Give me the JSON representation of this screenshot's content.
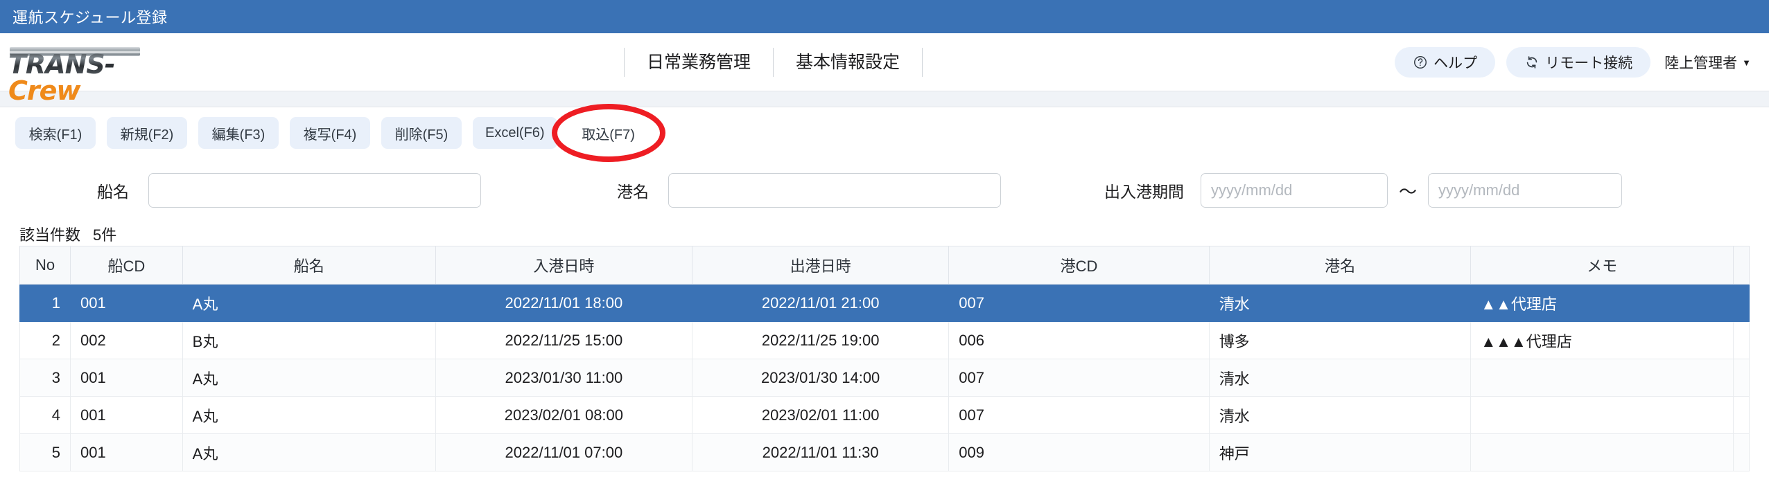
{
  "window": {
    "title": "運航スケジュール登録"
  },
  "brand": {
    "trans": "TRANS",
    "dash": "-",
    "crew": "Crew"
  },
  "nav": {
    "items": [
      {
        "label": "日常業務管理"
      },
      {
        "label": "基本情報設定"
      }
    ]
  },
  "header_actions": {
    "help": {
      "label": "ヘルプ",
      "icon": "question-circle-icon",
      "glyph": "?"
    },
    "remote": {
      "label": "リモート接続",
      "icon": "sync-icon",
      "glyph": "↻"
    },
    "user": {
      "label": "陸上管理者",
      "caret": "▼"
    }
  },
  "toolbar": {
    "buttons": [
      {
        "label": "検索(F1)",
        "highlighted": false
      },
      {
        "label": "新規(F2)",
        "highlighted": false
      },
      {
        "label": "編集(F3)",
        "highlighted": false
      },
      {
        "label": "複写(F4)",
        "highlighted": false
      },
      {
        "label": "削除(F5)",
        "highlighted": false
      },
      {
        "label": "Excel(F6)",
        "highlighted": false
      },
      {
        "label": "取込(F7)",
        "highlighted": true
      }
    ],
    "highlight_color": "#ee1d23"
  },
  "filters": {
    "ship_name": {
      "label": "船名",
      "value": "",
      "placeholder": ""
    },
    "port_name": {
      "label": "港名",
      "value": "",
      "placeholder": ""
    },
    "period": {
      "label": "出入港期間",
      "separator": "〜",
      "from": {
        "value": "",
        "placeholder": "yyyy/mm/dd"
      },
      "to": {
        "value": "",
        "placeholder": "yyyy/mm/dd"
      }
    }
  },
  "result": {
    "count_label": "該当件数",
    "count_text": "5件"
  },
  "table": {
    "columns": [
      "No",
      "船CD",
      "船名",
      "入港日時",
      "出港日時",
      "港CD",
      "港名",
      "メモ"
    ],
    "rows": [
      {
        "no": "1",
        "ship_cd": "001",
        "ship_name": "A丸",
        "arrival": "2022/11/01 18:00",
        "departure": "2022/11/01 21:00",
        "port_cd": "007",
        "port_name": "清水",
        "memo": "▲▲代理店",
        "selected": true
      },
      {
        "no": "2",
        "ship_cd": "002",
        "ship_name": "B丸",
        "arrival": "2022/11/25 15:00",
        "departure": "2022/11/25 19:00",
        "port_cd": "006",
        "port_name": "博多",
        "memo": "▲▲▲代理店",
        "selected": false
      },
      {
        "no": "3",
        "ship_cd": "001",
        "ship_name": "A丸",
        "arrival": "2023/01/30 11:00",
        "departure": "2023/01/30 14:00",
        "port_cd": "007",
        "port_name": "清水",
        "memo": "",
        "selected": false
      },
      {
        "no": "4",
        "ship_cd": "001",
        "ship_name": "A丸",
        "arrival": "2023/02/01 08:00",
        "departure": "2023/02/01 11:00",
        "port_cd": "007",
        "port_name": "清水",
        "memo": "",
        "selected": false
      },
      {
        "no": "5",
        "ship_cd": "001",
        "ship_name": "A丸",
        "arrival": "2022/11/01 07:00",
        "departure": "2022/11/01 11:30",
        "port_cd": "009",
        "port_name": "神戸",
        "memo": "",
        "selected": false
      }
    ]
  },
  "colors": {
    "title_bar": "#3a72b5",
    "selected_row": "#3a72b5",
    "pill_bg": "#eaf1fb",
    "toolbar_btn": "#e9f0fa",
    "logo_orange": "#ef8a1b"
  }
}
